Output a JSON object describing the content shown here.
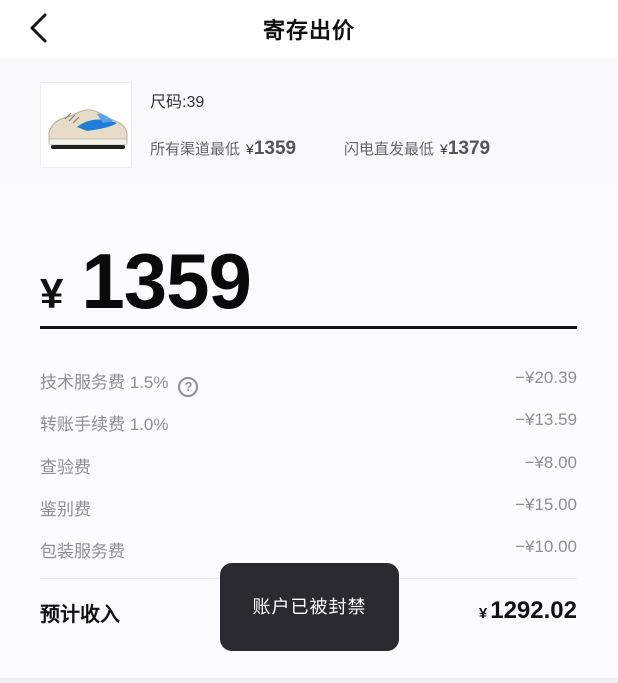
{
  "nav": {
    "title": "寄存出价",
    "back_icon": "chevron-left-icon"
  },
  "product": {
    "image": "sneaker-thumbnail",
    "size_text": "尺码:39",
    "all_channels_lowest": {
      "label": "所有渠道最低",
      "currency": "¥",
      "value": "1359"
    },
    "flash_direct_lowest": {
      "label": "闪电直发最低",
      "currency": "¥",
      "value": "1379"
    }
  },
  "bid": {
    "currency": "¥",
    "price": "1359"
  },
  "fees": [
    {
      "label": "技术服务费 1.5%",
      "amount": "−¥20.39",
      "help_icon": "question-circle-icon",
      "help_text": "?"
    },
    {
      "label": "转账手续费 1.0%",
      "amount": "−¥13.59"
    },
    {
      "label": "查验费",
      "amount": "−¥8.00"
    },
    {
      "label": "鉴别费",
      "amount": "−¥15.00"
    },
    {
      "label": "包装服务费",
      "amount": "−¥10.00"
    }
  ],
  "income": {
    "label": "预计收入",
    "currency": "¥",
    "value": "1292.02"
  },
  "toast": {
    "message": "账户已被封禁"
  },
  "colors": {
    "text_primary": "#111111",
    "text_muted": "#8e8e95",
    "toast_bg": "#2b2a30",
    "sneaker_blue": "#1f7fd6"
  }
}
